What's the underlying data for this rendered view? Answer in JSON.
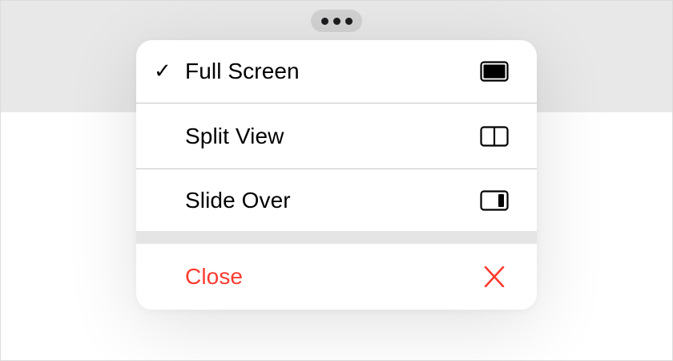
{
  "colors": {
    "accent_destructive": "#ff3b30",
    "top_band": "#e8e8e8",
    "pill": "#d2d2d2",
    "text": "#000000"
  },
  "multitasking_button": {
    "icon": "ellipsis-icon"
  },
  "menu": {
    "items": [
      {
        "label": "Full Screen",
        "checked": true,
        "check_glyph": "✓",
        "icon": "full-screen-icon"
      },
      {
        "label": "Split View",
        "checked": false,
        "icon": "split-view-icon"
      },
      {
        "label": "Slide Over",
        "checked": false,
        "icon": "slide-over-icon"
      }
    ],
    "close": {
      "label": "Close",
      "icon": "close-icon"
    }
  }
}
